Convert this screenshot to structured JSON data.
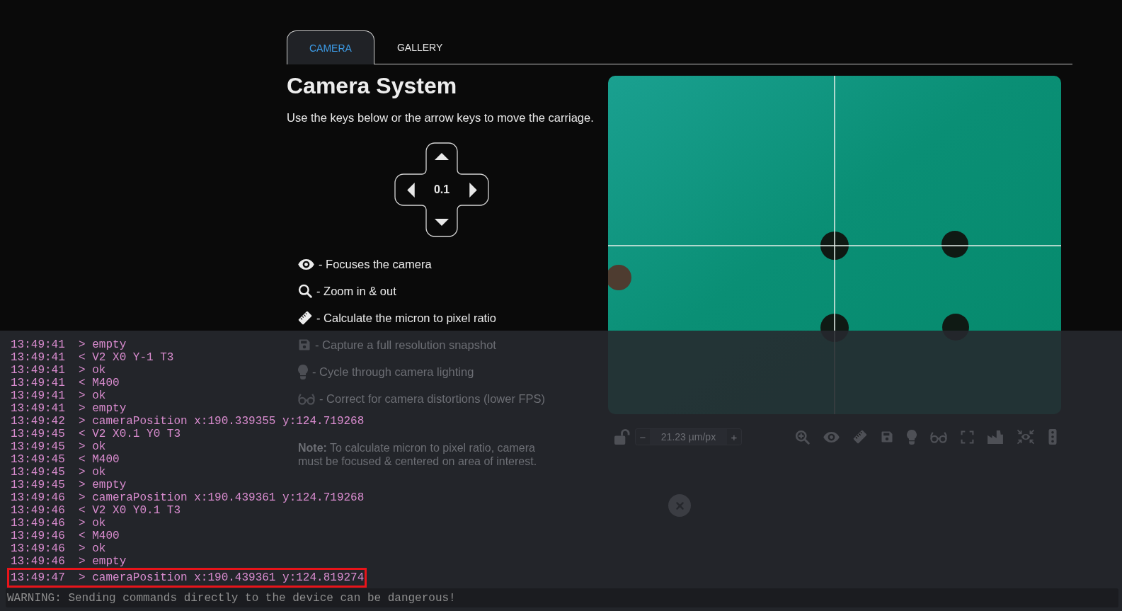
{
  "tabs": [
    {
      "label": "CAMERA",
      "selected": true
    },
    {
      "label": "GALLERY",
      "selected": false
    }
  ],
  "camera_controls": {
    "title": "Camera System",
    "instructions": "Use the keys below or the arrow keys to move the carriage.",
    "jog_step": "0.1",
    "legend": [
      {
        "kind": "focus",
        "text": "- Focuses the camera"
      },
      {
        "kind": "zoom",
        "text": "- Zoom in & out"
      },
      {
        "kind": "calibrate",
        "text": "- Calculate the micron to pixel ratio"
      },
      {
        "kind": "snapshot",
        "text": "- Capture a full resolution snapshot"
      },
      {
        "kind": "lighting",
        "text": "- Cycle through camera lighting"
      },
      {
        "kind": "distortion",
        "text": "- Correct for camera distortions (lower FPS)"
      }
    ],
    "note": "**Note:** To calculate micron to pixel ratio, camera must be focused & centered on area of interest."
  },
  "camera_toolbar": {
    "scale_locked": false,
    "scale": {
      "decrement": "−",
      "value": "21.23 µm/px",
      "increment": "+"
    }
  },
  "console": {
    "lines": [
      {
        "text": "13:49:41  > empty",
        "highlighted": false
      },
      {
        "text": "13:49:41  < V2 X0 Y-1 T3",
        "highlighted": false
      },
      {
        "text": "13:49:41  > ok",
        "highlighted": false
      },
      {
        "text": "13:49:41  < M400",
        "highlighted": false
      },
      {
        "text": "13:49:41  > ok",
        "highlighted": false
      },
      {
        "text": "13:49:41  > empty",
        "highlighted": false
      },
      {
        "text": "13:49:42  > cameraPosition x:190.339355 y:124.719268",
        "highlighted": false
      },
      {
        "text": "13:49:45  < V2 X0.1 Y0 T3",
        "highlighted": false
      },
      {
        "text": "13:49:45  > ok",
        "highlighted": false
      },
      {
        "text": "13:49:45  < M400",
        "highlighted": false
      },
      {
        "text": "13:49:45  > ok",
        "highlighted": false
      },
      {
        "text": "13:49:45  > empty",
        "highlighted": false
      },
      {
        "text": "13:49:46  > cameraPosition x:190.439361 y:124.719268",
        "highlighted": false
      },
      {
        "text": "13:49:46  < V2 X0 Y0.1 T3",
        "highlighted": false
      },
      {
        "text": "13:49:46  > ok",
        "highlighted": false
      },
      {
        "text": "13:49:46  < M400",
        "highlighted": false
      },
      {
        "text": "13:49:46  > ok",
        "highlighted": false
      },
      {
        "text": "13:49:46  > empty",
        "highlighted": false
      },
      {
        "text": "13:49:47  > cameraPosition x:190.439361 y:124.819274",
        "highlighted": true
      }
    ],
    "command_input": {
      "placeholder": "WARNING: Sending commands directly to the device can be dangerous!"
    }
  }
}
